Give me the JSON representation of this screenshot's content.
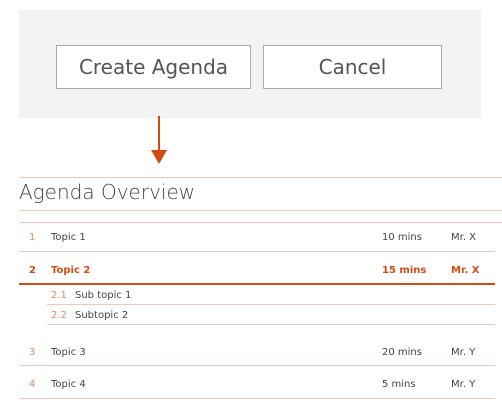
{
  "dialog": {
    "create_label": "Create Agenda",
    "cancel_label": "Cancel"
  },
  "agenda": {
    "title": "Agenda Overview",
    "rows": [
      {
        "num": "1",
        "title": "Topic 1",
        "duration": "10 mins",
        "presenter": "Mr. X"
      },
      {
        "num": "2",
        "title": "Topic 2",
        "duration": "15 mins",
        "presenter": "Mr. X"
      },
      {
        "num": "3",
        "title": "Topic 3",
        "duration": "20 mins",
        "presenter": "Mr. Y"
      },
      {
        "num": "4",
        "title": "Topic 4",
        "duration": "5 mins",
        "presenter": "Mr. Y"
      }
    ],
    "subtopics": [
      {
        "num": "2.1",
        "title": "Sub topic 1"
      },
      {
        "num": "2.2",
        "title": "Subtopic 2"
      }
    ]
  },
  "colors": {
    "accent": "#d24b11",
    "accent_light": "#f4c7b4",
    "dialog_bg": "#f3f3f3"
  }
}
